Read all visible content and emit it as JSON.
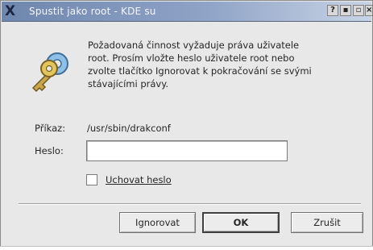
{
  "window": {
    "title": "Spustit jako root - KDE su",
    "title_icon": "X",
    "buttons": {
      "help": "?",
      "minimize": "▪",
      "maximize": "▫",
      "close": "×"
    }
  },
  "message": {
    "lines": [
      "Požadovaná činnost vyžaduje práva uživatele",
      "root. Prosím vložte heslo uživatele root nebo",
      "zvolte tlačítko Ignorovat k pokračování se svými",
      "stávajícími právy."
    ]
  },
  "form": {
    "command_label": "Příkaz:",
    "command_value": "/usr/sbin/drakconf",
    "password_label": "Heslo:",
    "password_value": "",
    "remember_label": "Uchovat heslo",
    "remember_checked": false
  },
  "buttons": {
    "ignore": "Ignorovat",
    "ok": "OK",
    "cancel": "Zrušit"
  },
  "icons": {
    "dialog": "keys-icon"
  },
  "colors": {
    "titlebar_start": "#6f86ad",
    "titlebar_end": "#c9d4e6",
    "dialog_bg": "#e8e8e8"
  }
}
